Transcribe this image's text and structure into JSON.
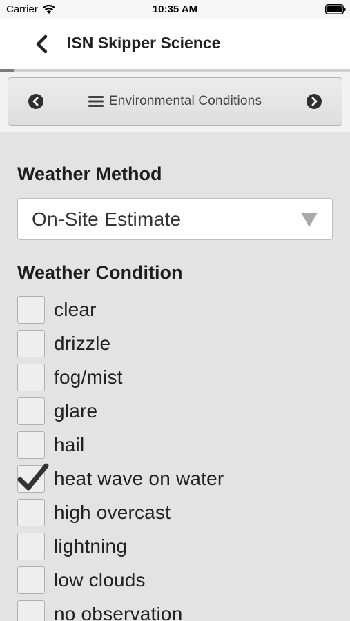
{
  "status_bar": {
    "carrier": "Carrier",
    "time": "10:35 AM",
    "wifi_icon": "wifi-icon",
    "battery_icon": "battery-icon"
  },
  "nav_bar": {
    "back_icon": "chevron-left-icon",
    "title": "ISN Skipper Science",
    "progress_percent": 4
  },
  "section_nav": {
    "prev_icon": "circle-chevron-left-icon",
    "menu_icon": "hamburger-menu-icon",
    "section_label": "Environmental Conditions",
    "next_icon": "circle-chevron-right-icon"
  },
  "weather_method": {
    "title": "Weather Method",
    "selected_value": "On-Site Estimate",
    "dropdown_icon": "triangle-down-icon"
  },
  "weather_condition": {
    "title": "Weather Condition",
    "options": [
      {
        "label": "clear",
        "checked": false
      },
      {
        "label": "drizzle",
        "checked": false
      },
      {
        "label": "fog/mist",
        "checked": false
      },
      {
        "label": "glare",
        "checked": false
      },
      {
        "label": "hail",
        "checked": false
      },
      {
        "label": "heat wave on water",
        "checked": true
      },
      {
        "label": "high overcast",
        "checked": false
      },
      {
        "label": "lightning",
        "checked": false
      },
      {
        "label": "low clouds",
        "checked": false
      },
      {
        "label": "no observation",
        "checked": false
      }
    ]
  },
  "colors": {
    "background": "#e3e3e3",
    "nav_background": "#ffffff",
    "text": "#222222",
    "progress": "#7c7c7c"
  }
}
